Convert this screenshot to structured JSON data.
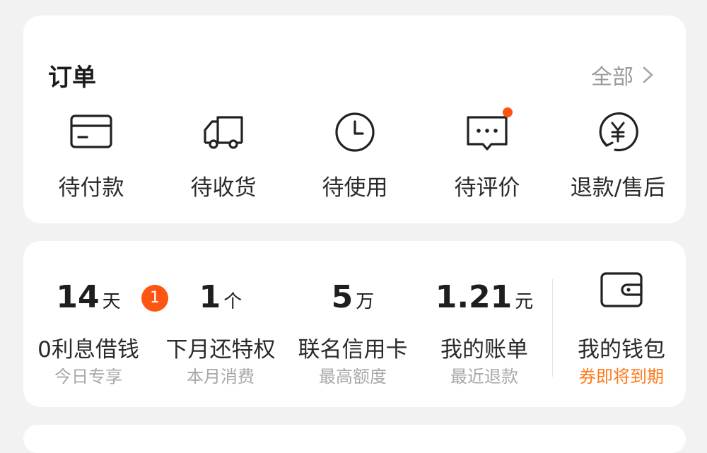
{
  "orders": {
    "title": "订单",
    "all_label": "全部",
    "items": [
      {
        "label": "待付款",
        "icon": "card-icon"
      },
      {
        "label": "待收货",
        "icon": "truck-icon"
      },
      {
        "label": "待使用",
        "icon": "clock-icon"
      },
      {
        "label": "待评价",
        "icon": "comment-icon",
        "has_dot": true
      },
      {
        "label": "退款/售后",
        "icon": "yuan-refund-icon"
      }
    ]
  },
  "finance": {
    "items": [
      {
        "value": "14",
        "unit": "天",
        "title": "0利息借钱",
        "sub": "今日专享",
        "badge": "1"
      },
      {
        "value": "1",
        "unit": "个",
        "title": "下月还特权",
        "sub": "本月消费"
      },
      {
        "value": "5",
        "unit": "万",
        "title": "联名信用卡",
        "sub": "最高额度"
      },
      {
        "value": "1.21",
        "unit": "元",
        "title": "我的账单",
        "sub": "最近退款"
      }
    ],
    "wallet": {
      "title": "我的钱包",
      "sub": "券即将到期",
      "icon": "wallet-icon"
    }
  },
  "colors": {
    "accent": "#ff5512",
    "accent_text": "#ff7a1a",
    "muted": "#a8a8a8"
  }
}
